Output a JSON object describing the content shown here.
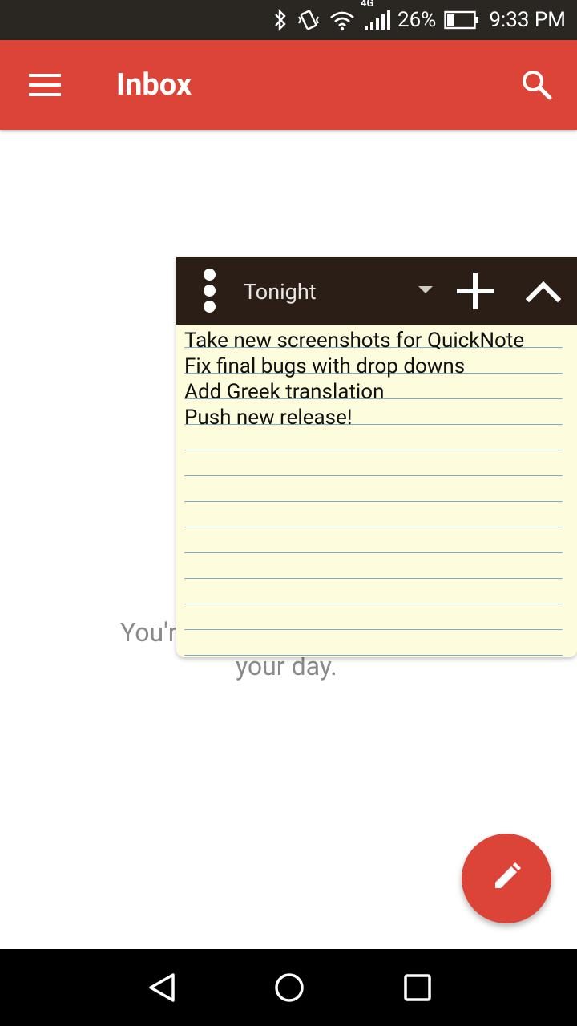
{
  "status_bar": {
    "icons": [
      "bluetooth-icon",
      "vibrate-icon",
      "wifi-icon",
      "signal-4g-icon"
    ],
    "network_label": "4G",
    "battery_percent": "26%",
    "time": "9:33 PM"
  },
  "app_bar": {
    "title": "Inbox",
    "menu_icon": "menu-icon",
    "search_icon": "search-icon",
    "color": "#db4437"
  },
  "empty_state": {
    "line1": "You'r",
    "line2": "your day."
  },
  "quicknote": {
    "list_name": "Tonight",
    "items": [
      "Take new screenshots for QuickNote",
      "Fix final bugs with drop downs",
      "Add Greek translation",
      "Push new release!"
    ],
    "header_color": "#2b1e16",
    "paper_color": "#fdfddd"
  },
  "fab": {
    "icon": "pencil-icon",
    "color": "#db4437"
  },
  "nav_bar": {
    "icons": [
      "back-icon",
      "home-icon",
      "recents-icon"
    ]
  }
}
